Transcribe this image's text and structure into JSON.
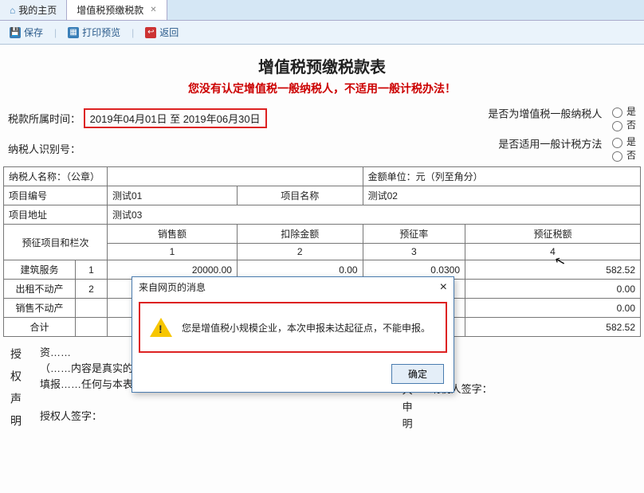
{
  "tabs": {
    "home": "我的主页",
    "current": "增值税预缴税款"
  },
  "toolbar": {
    "save": "保存",
    "preview": "打印预览",
    "back": "返回"
  },
  "title": "增值税预缴税款表",
  "warning_line": "您没有认定增值税一般纳税人，不适用一般计税办法！",
  "period_label": "税款所属时间：",
  "period_value": "2019年04月01日 至 2019年06月30日",
  "is_general_label": "是否为增值税一般纳税人",
  "use_general_method_label": "是否适用一般计税方法",
  "opt_yes": "是",
  "opt_no": "否",
  "taxpayer_id_label": "纳税人识别号：",
  "taxpayer_id_value": "",
  "taxpayer_name_label": "纳税人名称：（公章）",
  "taxpayer_name_value": "",
  "currency_unit": "金额单位：元（列至角分）",
  "headers": {
    "project_no": "项目编号",
    "project_name": "项目名称",
    "project_addr": "项目地址",
    "section": "预征项目和栏次",
    "col1": "销售额",
    "col2": "扣除金额",
    "col3": "预征率",
    "col4": "预征税额"
  },
  "project_no_val": "测试01",
  "project_name_val": "测试02",
  "project_addr_val": "测试03",
  "col_index": {
    "c1": "1",
    "c2": "2",
    "c3": "3",
    "c4": "4"
  },
  "rows": [
    {
      "name": "建筑服务",
      "idx": "1",
      "c1": "20000.00",
      "c2": "0.00",
      "c3": "0.0300",
      "c4": "582.52"
    },
    {
      "name": "出租不动产",
      "idx": "2",
      "c1": "",
      "c2": "",
      "c3": "",
      "c4": "0.00"
    },
    {
      "name": "销售不动产",
      "idx": "",
      "c1": "",
      "c2": "",
      "c3": "",
      "c4": "0.00"
    },
    {
      "name": "合计",
      "idx": "",
      "c1": "",
      "c2": "",
      "c3": "",
      "c4": "582.52"
    }
  ],
  "sqsm": {
    "title": "授权声明",
    "body1": "资……",
    "body2": "（……内容是真实的、可靠的、完整的。",
    "body3": "填报……任何与本表有关的往来文件，都可寄予此人。",
    "signer1_label": "授权人签字：",
    "right_title": "纳税人申明",
    "signer2_label": "纳税人签字："
  },
  "dialog": {
    "title": "来自网页的消息",
    "message": "您是增值税小规模企业，本次申报未达起征点，不能申报。",
    "ok": "确定"
  }
}
